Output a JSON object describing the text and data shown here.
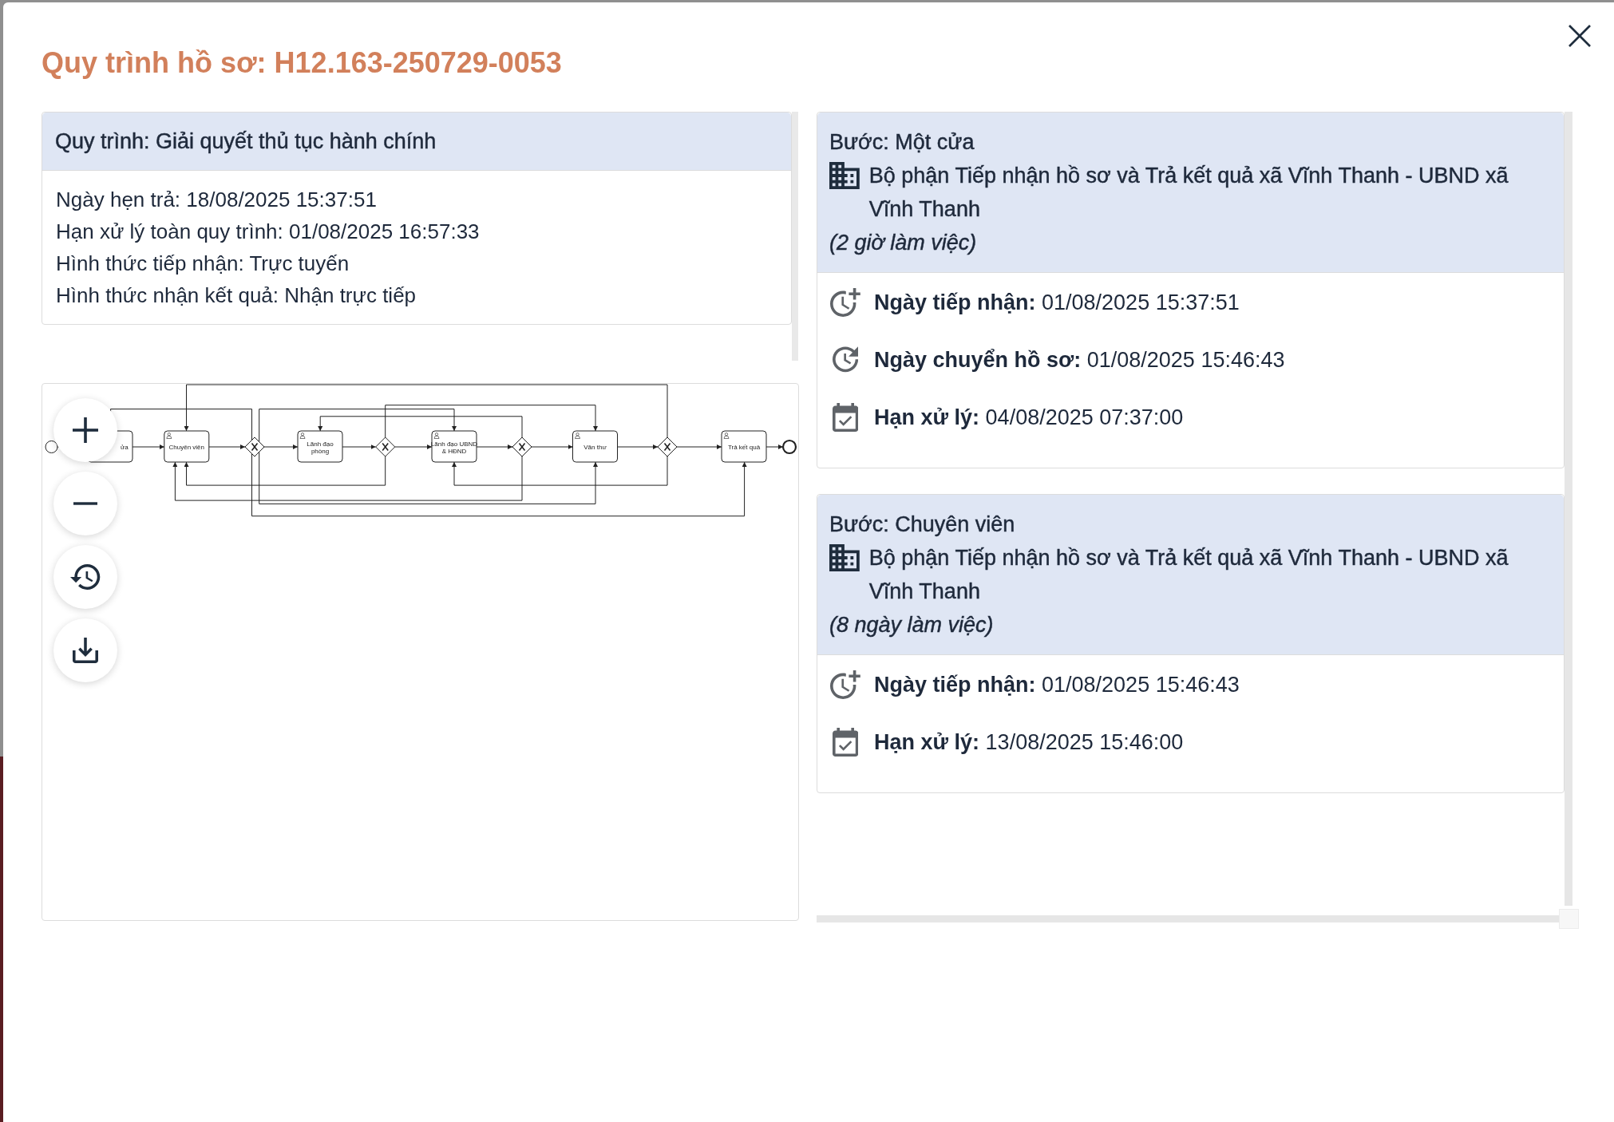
{
  "dialog": {
    "title": "Quy trình hồ sơ: H12.163-250729-0053"
  },
  "process": {
    "title": "Quy trình: Giải quyết thủ tục hành chính",
    "details": [
      "Ngày hẹn trả: 18/08/2025 15:37:51",
      "Hạn xử lý toàn quy trình: 01/08/2025 16:57:33",
      "Hình thức tiếp nhận: Trực tuyến",
      "Hình thức nhận kết quả: Nhận trực tiếp"
    ]
  },
  "diagram": {
    "nodes": [
      {
        "kind": "start"
      },
      {
        "kind": "task",
        "label": "ửa"
      },
      {
        "kind": "task",
        "label": "Chuyên viên"
      },
      {
        "kind": "gateway"
      },
      {
        "kind": "task",
        "label": "Lãnh đạo phòng"
      },
      {
        "kind": "gateway"
      },
      {
        "kind": "task",
        "label": "Lãnh đạo UBND & HĐND"
      },
      {
        "kind": "gateway"
      },
      {
        "kind": "task",
        "label": "Văn thư"
      },
      {
        "kind": "gateway"
      },
      {
        "kind": "task",
        "label": "Trả kết quả"
      },
      {
        "kind": "end"
      }
    ]
  },
  "steps": [
    {
      "title": "Bước: Một cửa",
      "department": "Bộ phận Tiếp nhận hồ sơ và Trả kết quả xã Vĩnh Thanh - UBND xã Vĩnh Thanh",
      "duration": "(2 giờ làm việc)",
      "events": [
        {
          "kind": "received",
          "text": "**Ngày tiếp nhận:** 01/08/2025 15:37:51"
        },
        {
          "kind": "transferred",
          "text": "**Ngày chuyển hồ sơ:** 01/08/2025 15:46:43"
        },
        {
          "kind": "deadline",
          "text": "**Hạn xử lý:** 04/08/2025 07:37:00"
        }
      ]
    },
    {
      "title": "Bước: Chuyên viên",
      "department": "Bộ phận Tiếp nhận hồ sơ và Trả kết quả xã Vĩnh Thanh - UBND xã Vĩnh Thanh",
      "duration": "(8 ngày làm việc)",
      "events": [
        {
          "kind": "received",
          "text": "**Ngày tiếp nhận:** 01/08/2025 15:46:43"
        },
        {
          "kind": "deadline",
          "text": "**Hạn xử lý:** 13/08/2025 15:46:00"
        }
      ]
    }
  ]
}
